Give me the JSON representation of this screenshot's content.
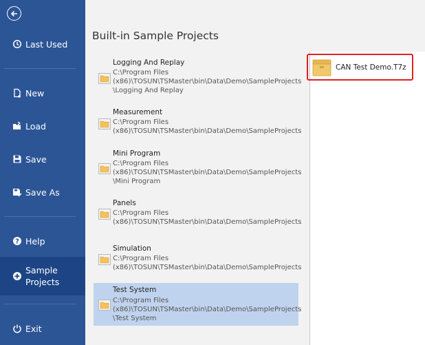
{
  "sidebar": {
    "back_label": "Back",
    "items": [
      {
        "label": "Last Used",
        "icon": "history-icon"
      },
      {
        "label": "New",
        "icon": "new-file-icon"
      },
      {
        "label": "Load",
        "icon": "open-folder-icon"
      },
      {
        "label": "Save",
        "icon": "floppy-disk-icon"
      },
      {
        "label": "Save As",
        "icon": "save-as-icon"
      },
      {
        "label": "Help",
        "icon": "help-icon"
      },
      {
        "label_line1": "Sample",
        "label_line2": "Projects",
        "icon": "plus-circle-icon"
      },
      {
        "label": "Exit",
        "icon": "power-icon"
      }
    ]
  },
  "main": {
    "title": "Built-in Sample Projects",
    "projects": [
      {
        "name": "Logging And Replay",
        "path": [
          "C:\\Program Files",
          "(x86)\\TOSUN\\TSMaster\\bin\\Data\\Demo\\SampleProjects",
          "\\Logging And Replay"
        ]
      },
      {
        "name": "Measurement",
        "path": [
          "C:\\Program Files",
          "(x86)\\TOSUN\\TSMaster\\bin\\Data\\Demo\\SampleProjects"
        ]
      },
      {
        "name": "Mini Program",
        "path": [
          "C:\\Program Files",
          "(x86)\\TOSUN\\TSMaster\\bin\\Data\\Demo\\SampleProjects",
          "\\Mini Program"
        ]
      },
      {
        "name": "Panels",
        "path": [
          "C:\\Program Files",
          "(x86)\\TOSUN\\TSMaster\\bin\\Data\\Demo\\SampleProjects"
        ]
      },
      {
        "name": "Simulation",
        "path": [
          "C:\\Program Files",
          "(x86)\\TOSUN\\TSMaster\\bin\\Data\\Demo\\SampleProjects"
        ]
      },
      {
        "name": "Test System",
        "path": [
          "C:\\Program Files",
          "(x86)\\TOSUN\\TSMaster\\bin\\Data\\Demo\\SampleProjects",
          "\\Test System"
        ]
      }
    ],
    "selected_project": "Test System",
    "files": [
      {
        "name": "CAN Test Demo.T7z",
        "icon": "archive-icon"
      }
    ]
  },
  "colors": {
    "sidebar": "#2c5596",
    "sidebar_active": "#1d4585",
    "selected_row": "#c0d3ee",
    "highlight_border": "#e02020",
    "folder": "#f5c15c"
  }
}
